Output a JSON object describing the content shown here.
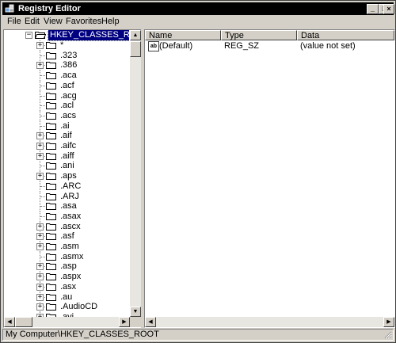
{
  "window": {
    "title": "Registry Editor",
    "minimize_glyph": "_",
    "maximize_glyph": "□",
    "close_glyph": "×"
  },
  "menu": [
    {
      "label": "File"
    },
    {
      "label": "Edit"
    },
    {
      "label": "View"
    },
    {
      "label": "Favorites"
    },
    {
      "label": "Help"
    }
  ],
  "tree": {
    "root": {
      "label": "HKEY_CLASSES_ROOT",
      "expander": "−"
    },
    "items": [
      {
        "label": "*",
        "expandable": true
      },
      {
        "label": ".323",
        "expandable": false
      },
      {
        "label": ".386",
        "expandable": true
      },
      {
        "label": ".aca",
        "expandable": false
      },
      {
        "label": ".acf",
        "expandable": false
      },
      {
        "label": ".acg",
        "expandable": false
      },
      {
        "label": ".acl",
        "expandable": false
      },
      {
        "label": ".acs",
        "expandable": false
      },
      {
        "label": ".ai",
        "expandable": false
      },
      {
        "label": ".aif",
        "expandable": true
      },
      {
        "label": ".aifc",
        "expandable": true
      },
      {
        "label": ".aiff",
        "expandable": true
      },
      {
        "label": ".ani",
        "expandable": false
      },
      {
        "label": ".aps",
        "expandable": true
      },
      {
        "label": ".ARC",
        "expandable": false
      },
      {
        "label": ".ARJ",
        "expandable": false
      },
      {
        "label": ".asa",
        "expandable": false
      },
      {
        "label": ".asax",
        "expandable": false
      },
      {
        "label": ".ascx",
        "expandable": true
      },
      {
        "label": ".asf",
        "expandable": true
      },
      {
        "label": ".asm",
        "expandable": true
      },
      {
        "label": ".asmx",
        "expandable": false
      },
      {
        "label": ".asp",
        "expandable": true
      },
      {
        "label": ".aspx",
        "expandable": true
      },
      {
        "label": ".asx",
        "expandable": true
      },
      {
        "label": ".au",
        "expandable": true
      },
      {
        "label": ".AudioCD",
        "expandable": true
      },
      {
        "label": ".avi",
        "expandable": true
      }
    ]
  },
  "list": {
    "columns": [
      {
        "label": "Name"
      },
      {
        "label": "Type"
      },
      {
        "label": "Data"
      }
    ],
    "rows": [
      {
        "icon": "ab",
        "name": "(Default)",
        "type": "REG_SZ",
        "data": "(value not set)"
      }
    ]
  },
  "status": {
    "path": "My Computer\\HKEY_CLASSES_ROOT"
  },
  "colors": {
    "titlebar": "#000000",
    "selection": "#000080",
    "chrome": "#d4d0c8"
  }
}
